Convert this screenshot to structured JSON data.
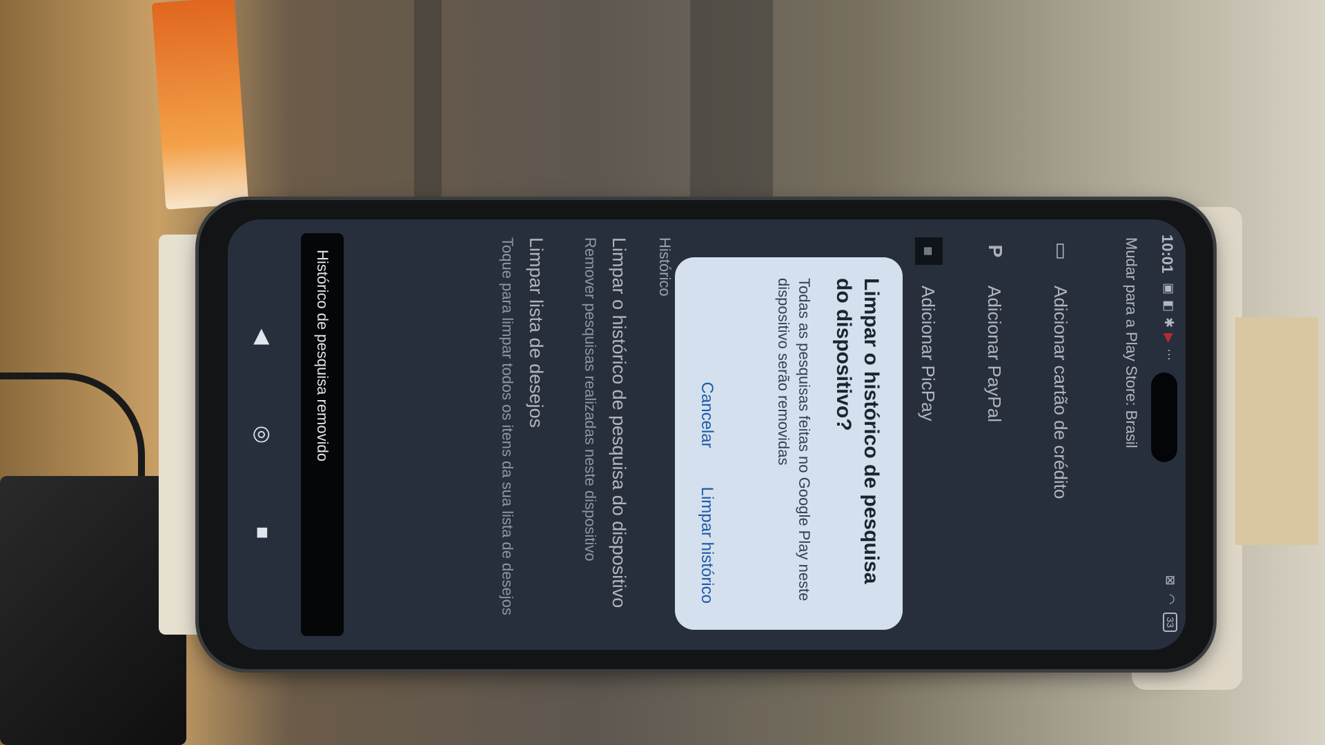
{
  "status": {
    "time": "10:01",
    "battery": "33"
  },
  "settings": {
    "country": "Mudar para a Play Store: Brasil",
    "items": [
      {
        "label": "Adicionar cartão de crédito",
        "icon": "credit-card-icon"
      },
      {
        "label": "Adicionar PayPal",
        "icon": "paypal-icon"
      },
      {
        "label": "Adicionar PicPay",
        "icon": "picpay-icon"
      }
    ]
  },
  "history": {
    "section_title": "Histórico",
    "clear_search": {
      "title": "Limpar o histórico de pesquisa do dispositivo",
      "subtitle": "Remover pesquisas realizadas neste dispositivo"
    },
    "clear_wishlist": {
      "title": "Limpar lista de desejos",
      "subtitle": "Toque para limpar todos os itens da sua lista de desejos"
    }
  },
  "dialog": {
    "title": "Limpar o histórico de pesquisa do dispositivo?",
    "body": "Todas as pesquisas feitas no Google Play neste dispositivo serão removidas",
    "cancel": "Cancelar",
    "confirm": "Limpar histórico"
  },
  "snackbar": {
    "message": "Histórico de pesquisa removido"
  },
  "colors": {
    "screen_bg": "#2f3947",
    "dialog_bg": "#d4e0ee",
    "accent": "#1e5aa8"
  }
}
